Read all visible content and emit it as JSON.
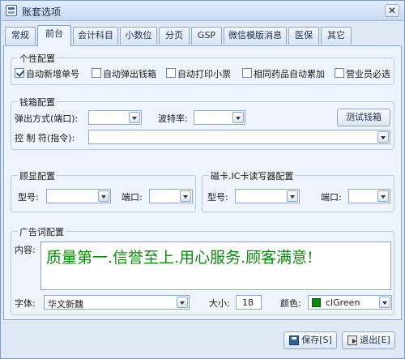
{
  "window": {
    "title": "账套选项",
    "close_glyph": "✕"
  },
  "tabs": [
    {
      "label": "常规"
    },
    {
      "label": "前台"
    },
    {
      "label": "会计科目"
    },
    {
      "label": "小数位"
    },
    {
      "label": "分页"
    },
    {
      "label": "GSP"
    },
    {
      "label": "微信模版消息"
    },
    {
      "label": "医保"
    },
    {
      "label": "其它"
    }
  ],
  "active_tab": "前台",
  "personal": {
    "title": "个性配置",
    "options": [
      {
        "label": "自动新增单号",
        "checked": true
      },
      {
        "label": "自动弹出钱箱",
        "checked": false
      },
      {
        "label": "自动打印小票",
        "checked": false
      },
      {
        "label": "相同药品自动累加",
        "checked": false
      },
      {
        "label": "营业员必选",
        "checked": false
      }
    ]
  },
  "cashbox": {
    "title": "钱箱配置",
    "popup_label": "弹出方式(端口):",
    "popup_value": "",
    "baud_label": "波特率:",
    "baud_value": "",
    "test_button": "测试钱箱",
    "command_label": "控 制 符(指令):",
    "command_value": ""
  },
  "display": {
    "title": "顾显配置",
    "model_label": "型号:",
    "model_value": "",
    "port_label": "端口:",
    "port_value": ""
  },
  "card_reader": {
    "title": "磁卡.IC卡读写器配置",
    "model_label": "型号:",
    "model_value": "",
    "port_label": "端口:",
    "port_value": ""
  },
  "advert": {
    "title": "广告词配置",
    "content_label": "内容:",
    "content": "质量第一.信誉至上.用心服务.顾客满意!",
    "font_label": "字体:",
    "font_value": "华文新魏",
    "size_label": "大小:",
    "size_value": "18",
    "color_label": "颜色:",
    "color_value": "clGreen",
    "color_hex": "#0a8a0a"
  },
  "footer": {
    "save_label": "保存[S]",
    "exit_label": "退出[E]"
  },
  "icons": {
    "save": "save-icon",
    "exit": "exit-icon",
    "close": "close-icon",
    "app": "app-icon"
  }
}
